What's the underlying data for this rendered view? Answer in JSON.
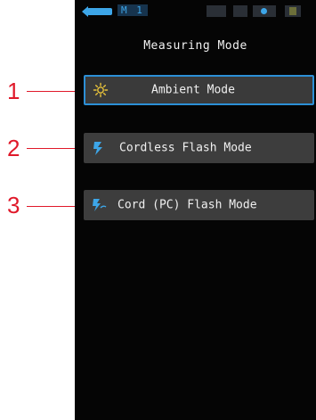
{
  "screen": {
    "status": {
      "memory_label": "M 1"
    },
    "title": "Measuring Mode",
    "modes": [
      {
        "label": "Ambient Mode",
        "icon": "sun-icon",
        "selected": true
      },
      {
        "label": "Cordless Flash Mode",
        "icon": "flash-icon",
        "selected": false
      },
      {
        "label": "Cord (PC) Flash Mode",
        "icon": "cord-flash-icon",
        "selected": false
      }
    ]
  },
  "callouts": [
    "1",
    "2",
    "3"
  ],
  "colors": {
    "accent": "#2c8fd6",
    "callout": "#e0192a",
    "sun_icon": "#e8c23a",
    "flash_icon": "#3da6e8",
    "button": "#3d3d3d",
    "screen_bg": "#050505"
  }
}
